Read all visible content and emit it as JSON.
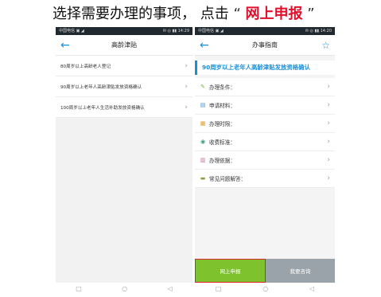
{
  "instruction": {
    "prefix": "选择需要办理的事项，   点击",
    "open_quote": "“",
    "highlight": "网上申报",
    "close_quote": "”",
    "highlight_color": "#e0102c"
  },
  "left_phone": {
    "status_left": "中国电信 ▣ ◢",
    "status_right": "✉ ◎ ▮▮ 14:29",
    "title": "高龄津贴",
    "items": [
      {
        "label": "80周岁以上高龄老人登记"
      },
      {
        "label": "90周岁以上老年人高龄津贴发放资格确认"
      },
      {
        "label": "100周岁以上老年人生活补助发放资格确认"
      }
    ],
    "nav": {
      "recent": "□",
      "home": "○",
      "back": "◁"
    }
  },
  "right_phone": {
    "status_left": "中国电信 ▣ ◢",
    "status_right": "✉ ◎ ▮▮ 14:20",
    "title": "办事指南",
    "header": "90周岁以上老年人高龄津贴发放资格确认",
    "items": [
      {
        "label": "办理条件：",
        "icon": "check-icon",
        "color": "#6fb43f"
      },
      {
        "label": "申请材料：",
        "icon": "document-icon",
        "color": "#3c8fd6"
      },
      {
        "label": "办理时限：",
        "icon": "calendar-icon",
        "color": "#e89a2c"
      },
      {
        "label": "收费标准：",
        "icon": "money-icon",
        "color": "#3aa07a"
      },
      {
        "label": "办理依据：",
        "icon": "book-icon",
        "color": "#c76f9f"
      },
      {
        "label": "常见问题解答：",
        "icon": "faq-icon",
        "color": "#8aa13a"
      }
    ],
    "apply_label": "网上申报",
    "consult_label": "我要咨询",
    "nav": {
      "recent": "□",
      "home": "○",
      "back": "◁"
    }
  },
  "colors": {
    "accent": "#1a8fd8",
    "apply_green": "#7ec22e",
    "consult_gray": "#9aa3aa"
  }
}
